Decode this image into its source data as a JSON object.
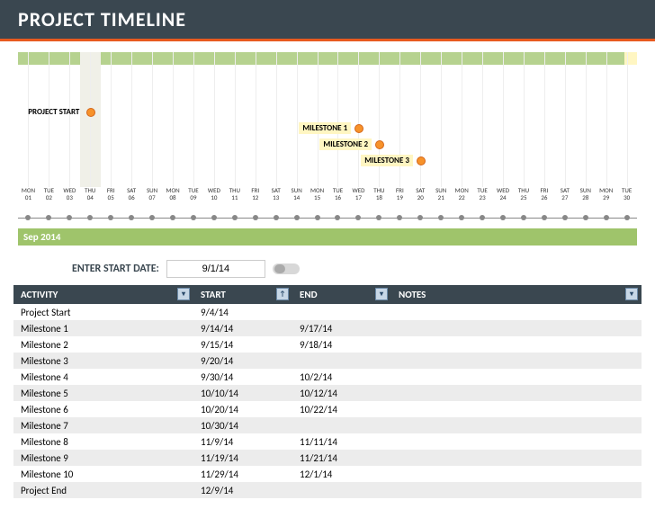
{
  "header": {
    "title": "PROJECT TIMELINE"
  },
  "timeline": {
    "month_label": "Sep 2014",
    "days": [
      {
        "dow": "MON",
        "num": "01"
      },
      {
        "dow": "TUE",
        "num": "02"
      },
      {
        "dow": "WED",
        "num": "03"
      },
      {
        "dow": "THU",
        "num": "04"
      },
      {
        "dow": "FRI",
        "num": "05"
      },
      {
        "dow": "SAT",
        "num": "06"
      },
      {
        "dow": "SUN",
        "num": "07"
      },
      {
        "dow": "MON",
        "num": "08"
      },
      {
        "dow": "TUE",
        "num": "09"
      },
      {
        "dow": "WED",
        "num": "10"
      },
      {
        "dow": "THU",
        "num": "11"
      },
      {
        "dow": "FRI",
        "num": "12"
      },
      {
        "dow": "SAT",
        "num": "13"
      },
      {
        "dow": "SUN",
        "num": "14"
      },
      {
        "dow": "MON",
        "num": "15"
      },
      {
        "dow": "TUE",
        "num": "16"
      },
      {
        "dow": "WED",
        "num": "17"
      },
      {
        "dow": "THU",
        "num": "18"
      },
      {
        "dow": "FRI",
        "num": "19"
      },
      {
        "dow": "SAT",
        "num": "20"
      },
      {
        "dow": "SUN",
        "num": "21"
      },
      {
        "dow": "MON",
        "num": "22"
      },
      {
        "dow": "TUE",
        "num": "23"
      },
      {
        "dow": "WED",
        "num": "24"
      },
      {
        "dow": "THU",
        "num": "25"
      },
      {
        "dow": "FRI",
        "num": "26"
      },
      {
        "dow": "SAT",
        "num": "27"
      },
      {
        "dow": "SUN",
        "num": "28"
      },
      {
        "dow": "MON",
        "num": "29"
      },
      {
        "dow": "TUE",
        "num": "30"
      }
    ],
    "milestones": [
      {
        "label": "PROJECT START",
        "day": 4,
        "row": 0
      },
      {
        "label": "MILESTONE 1",
        "day": 17,
        "row": 1
      },
      {
        "label": "MILESTONE 2",
        "day": 18,
        "row": 2
      },
      {
        "label": "MILESTONE 3",
        "day": 20,
        "row": 3
      }
    ]
  },
  "controls": {
    "label": "ENTER START DATE:",
    "value": "9/1/14"
  },
  "table": {
    "headers": {
      "activity": "ACTIVITY",
      "start": "START",
      "end": "END",
      "notes": "NOTES"
    },
    "rows": [
      {
        "activity": "Project Start",
        "start": "9/4/14",
        "end": ""
      },
      {
        "activity": "Milestone 1",
        "start": "9/14/14",
        "end": "9/17/14"
      },
      {
        "activity": "Milestone 2",
        "start": "9/15/14",
        "end": "9/18/14"
      },
      {
        "activity": "Milestone 3",
        "start": "9/20/14",
        "end": ""
      },
      {
        "activity": "Milestone 4",
        "start": "9/30/14",
        "end": "10/2/14"
      },
      {
        "activity": "Milestone 5",
        "start": "10/10/14",
        "end": "10/12/14"
      },
      {
        "activity": "Milestone 6",
        "start": "10/20/14",
        "end": "10/22/14"
      },
      {
        "activity": "Milestone 7",
        "start": "10/30/14",
        "end": ""
      },
      {
        "activity": "Milestone 8",
        "start": "11/9/14",
        "end": "11/11/14"
      },
      {
        "activity": "Milestone 9",
        "start": "11/19/14",
        "end": "11/21/14"
      },
      {
        "activity": "Milestone 10",
        "start": "11/29/14",
        "end": "12/1/14"
      },
      {
        "activity": "Project End",
        "start": "12/9/14",
        "end": ""
      }
    ]
  },
  "chart_data": {
    "type": "scatter",
    "title": "PROJECT TIMELINE",
    "xlabel": "Sep 2014",
    "x_range": [
      "2014-09-01",
      "2014-09-30"
    ],
    "series": [
      {
        "name": "PROJECT START",
        "x": "2014-09-04"
      },
      {
        "name": "MILESTONE 1",
        "x": "2014-09-17"
      },
      {
        "name": "MILESTONE 2",
        "x": "2014-09-18"
      },
      {
        "name": "MILESTONE 3",
        "x": "2014-09-20"
      }
    ]
  }
}
